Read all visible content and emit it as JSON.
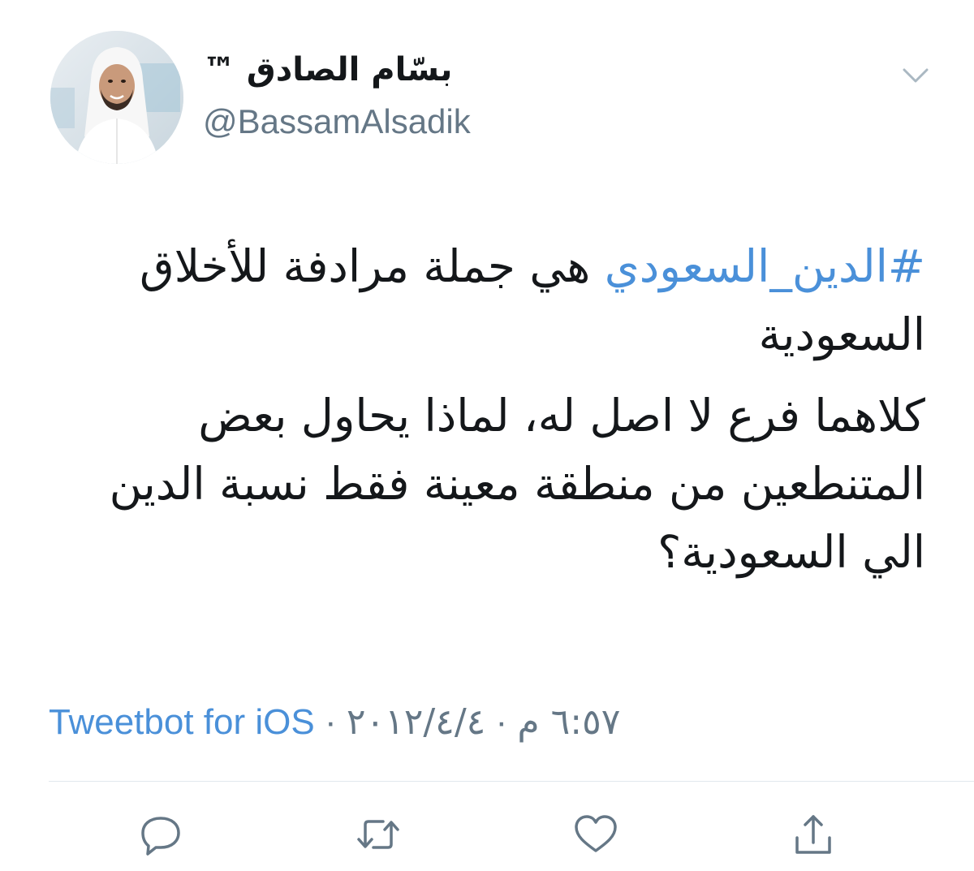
{
  "user": {
    "display_name": "بسّام الصادق ™",
    "handle": "@BassamAlsadik",
    "avatar_icon": "profile-photo"
  },
  "tweet": {
    "hashtag": "#الدين_السعودي",
    "line1_rest": " هي جملة مرادفة للأخلاق السعودية",
    "paragraph2": "كلاهما فرع لا اصل له، لماذا يحاول بعض المتنطعين من منطقة معينة فقط نسبة الدين الي السعودية؟"
  },
  "meta": {
    "source": "Tweetbot for iOS",
    "separator": "·",
    "date": "٢٠١٢/٤/٤",
    "time": "٦:٥٧ م"
  },
  "actions": {
    "reply_icon": "reply-icon",
    "retweet_icon": "retweet-icon",
    "like_icon": "heart-icon",
    "share_icon": "share-icon"
  },
  "colors": {
    "link": "#4a90d9",
    "secondary": "#657786",
    "text": "#14171a",
    "divider": "#e1e8ed"
  }
}
